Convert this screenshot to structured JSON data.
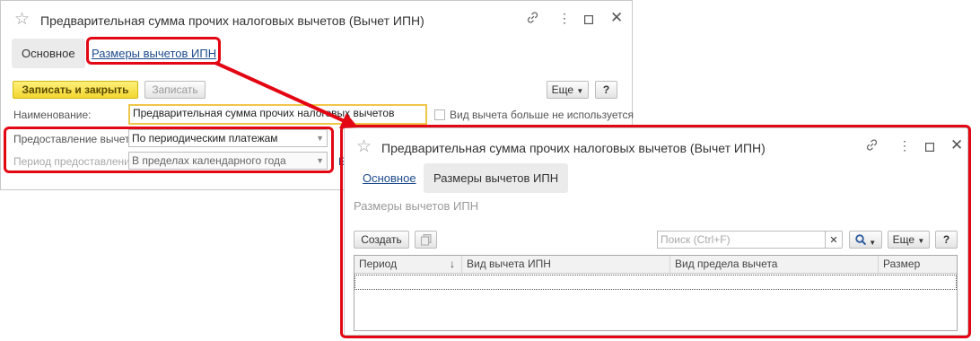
{
  "window1": {
    "title": "Предварительная сумма прочих налоговых вычетов (Вычет ИПН)",
    "tabs": [
      "Основное",
      "Размеры вычетов ИПН"
    ],
    "buttons": {
      "save_close": "Записать и закрыть",
      "save": "Записать",
      "more": "Еще",
      "help": "?"
    },
    "name_label": "Наименование:",
    "name_value": "Предварительная сумма прочих налоговых вычетов",
    "unused_label": "Вид вычета больше не используется",
    "provision_label": "Предоставление вычета:",
    "provision_value": "По периодическим платежам",
    "period_label": "Период предоставления:",
    "period_value": "В пределах календарного года"
  },
  "window2": {
    "title": "Предварительная сумма прочих налоговых вычетов (Вычет ИПН)",
    "tabs": [
      "Основное",
      "Размеры вычетов ИПН"
    ],
    "section_title": "Размеры вычетов ИПН",
    "buttons": {
      "create": "Создать",
      "more": "Еще",
      "help": "?"
    },
    "search_placeholder": "Поиск (Ctrl+F)",
    "columns": [
      "Период",
      "Вид вычета ИПН",
      "Вид предела вычета",
      "Размер"
    ],
    "sort_indicator": "↓"
  },
  "colors": {
    "highlight": "#e30613",
    "primary_button": "#f5dc3c",
    "link": "#1c4a8b"
  }
}
